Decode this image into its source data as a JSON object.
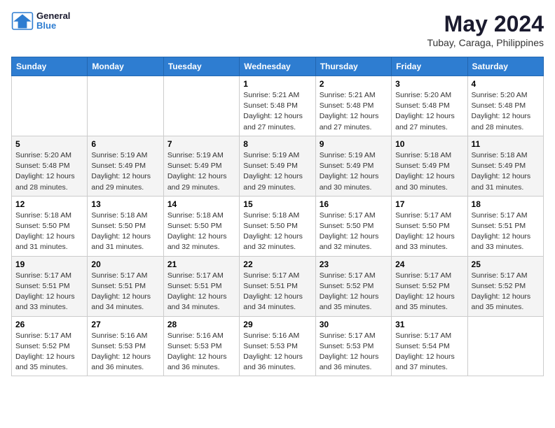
{
  "header": {
    "logo_line1": "General",
    "logo_line2": "Blue",
    "month_year": "May 2024",
    "location": "Tubay, Caraga, Philippines"
  },
  "days_of_week": [
    "Sunday",
    "Monday",
    "Tuesday",
    "Wednesday",
    "Thursday",
    "Friday",
    "Saturday"
  ],
  "weeks": [
    [
      {
        "day": "",
        "info": ""
      },
      {
        "day": "",
        "info": ""
      },
      {
        "day": "",
        "info": ""
      },
      {
        "day": "1",
        "info": "Sunrise: 5:21 AM\nSunset: 5:48 PM\nDaylight: 12 hours\nand 27 minutes."
      },
      {
        "day": "2",
        "info": "Sunrise: 5:21 AM\nSunset: 5:48 PM\nDaylight: 12 hours\nand 27 minutes."
      },
      {
        "day": "3",
        "info": "Sunrise: 5:20 AM\nSunset: 5:48 PM\nDaylight: 12 hours\nand 27 minutes."
      },
      {
        "day": "4",
        "info": "Sunrise: 5:20 AM\nSunset: 5:48 PM\nDaylight: 12 hours\nand 28 minutes."
      }
    ],
    [
      {
        "day": "5",
        "info": "Sunrise: 5:20 AM\nSunset: 5:48 PM\nDaylight: 12 hours\nand 28 minutes."
      },
      {
        "day": "6",
        "info": "Sunrise: 5:19 AM\nSunset: 5:49 PM\nDaylight: 12 hours\nand 29 minutes."
      },
      {
        "day": "7",
        "info": "Sunrise: 5:19 AM\nSunset: 5:49 PM\nDaylight: 12 hours\nand 29 minutes."
      },
      {
        "day": "8",
        "info": "Sunrise: 5:19 AM\nSunset: 5:49 PM\nDaylight: 12 hours\nand 29 minutes."
      },
      {
        "day": "9",
        "info": "Sunrise: 5:19 AM\nSunset: 5:49 PM\nDaylight: 12 hours\nand 30 minutes."
      },
      {
        "day": "10",
        "info": "Sunrise: 5:18 AM\nSunset: 5:49 PM\nDaylight: 12 hours\nand 30 minutes."
      },
      {
        "day": "11",
        "info": "Sunrise: 5:18 AM\nSunset: 5:49 PM\nDaylight: 12 hours\nand 31 minutes."
      }
    ],
    [
      {
        "day": "12",
        "info": "Sunrise: 5:18 AM\nSunset: 5:50 PM\nDaylight: 12 hours\nand 31 minutes."
      },
      {
        "day": "13",
        "info": "Sunrise: 5:18 AM\nSunset: 5:50 PM\nDaylight: 12 hours\nand 31 minutes."
      },
      {
        "day": "14",
        "info": "Sunrise: 5:18 AM\nSunset: 5:50 PM\nDaylight: 12 hours\nand 32 minutes."
      },
      {
        "day": "15",
        "info": "Sunrise: 5:18 AM\nSunset: 5:50 PM\nDaylight: 12 hours\nand 32 minutes."
      },
      {
        "day": "16",
        "info": "Sunrise: 5:17 AM\nSunset: 5:50 PM\nDaylight: 12 hours\nand 32 minutes."
      },
      {
        "day": "17",
        "info": "Sunrise: 5:17 AM\nSunset: 5:50 PM\nDaylight: 12 hours\nand 33 minutes."
      },
      {
        "day": "18",
        "info": "Sunrise: 5:17 AM\nSunset: 5:51 PM\nDaylight: 12 hours\nand 33 minutes."
      }
    ],
    [
      {
        "day": "19",
        "info": "Sunrise: 5:17 AM\nSunset: 5:51 PM\nDaylight: 12 hours\nand 33 minutes."
      },
      {
        "day": "20",
        "info": "Sunrise: 5:17 AM\nSunset: 5:51 PM\nDaylight: 12 hours\nand 34 minutes."
      },
      {
        "day": "21",
        "info": "Sunrise: 5:17 AM\nSunset: 5:51 PM\nDaylight: 12 hours\nand 34 minutes."
      },
      {
        "day": "22",
        "info": "Sunrise: 5:17 AM\nSunset: 5:51 PM\nDaylight: 12 hours\nand 34 minutes."
      },
      {
        "day": "23",
        "info": "Sunrise: 5:17 AM\nSunset: 5:52 PM\nDaylight: 12 hours\nand 35 minutes."
      },
      {
        "day": "24",
        "info": "Sunrise: 5:17 AM\nSunset: 5:52 PM\nDaylight: 12 hours\nand 35 minutes."
      },
      {
        "day": "25",
        "info": "Sunrise: 5:17 AM\nSunset: 5:52 PM\nDaylight: 12 hours\nand 35 minutes."
      }
    ],
    [
      {
        "day": "26",
        "info": "Sunrise: 5:17 AM\nSunset: 5:52 PM\nDaylight: 12 hours\nand 35 minutes."
      },
      {
        "day": "27",
        "info": "Sunrise: 5:16 AM\nSunset: 5:53 PM\nDaylight: 12 hours\nand 36 minutes."
      },
      {
        "day": "28",
        "info": "Sunrise: 5:16 AM\nSunset: 5:53 PM\nDaylight: 12 hours\nand 36 minutes."
      },
      {
        "day": "29",
        "info": "Sunrise: 5:16 AM\nSunset: 5:53 PM\nDaylight: 12 hours\nand 36 minutes."
      },
      {
        "day": "30",
        "info": "Sunrise: 5:17 AM\nSunset: 5:53 PM\nDaylight: 12 hours\nand 36 minutes."
      },
      {
        "day": "31",
        "info": "Sunrise: 5:17 AM\nSunset: 5:54 PM\nDaylight: 12 hours\nand 37 minutes."
      },
      {
        "day": "",
        "info": ""
      }
    ]
  ]
}
